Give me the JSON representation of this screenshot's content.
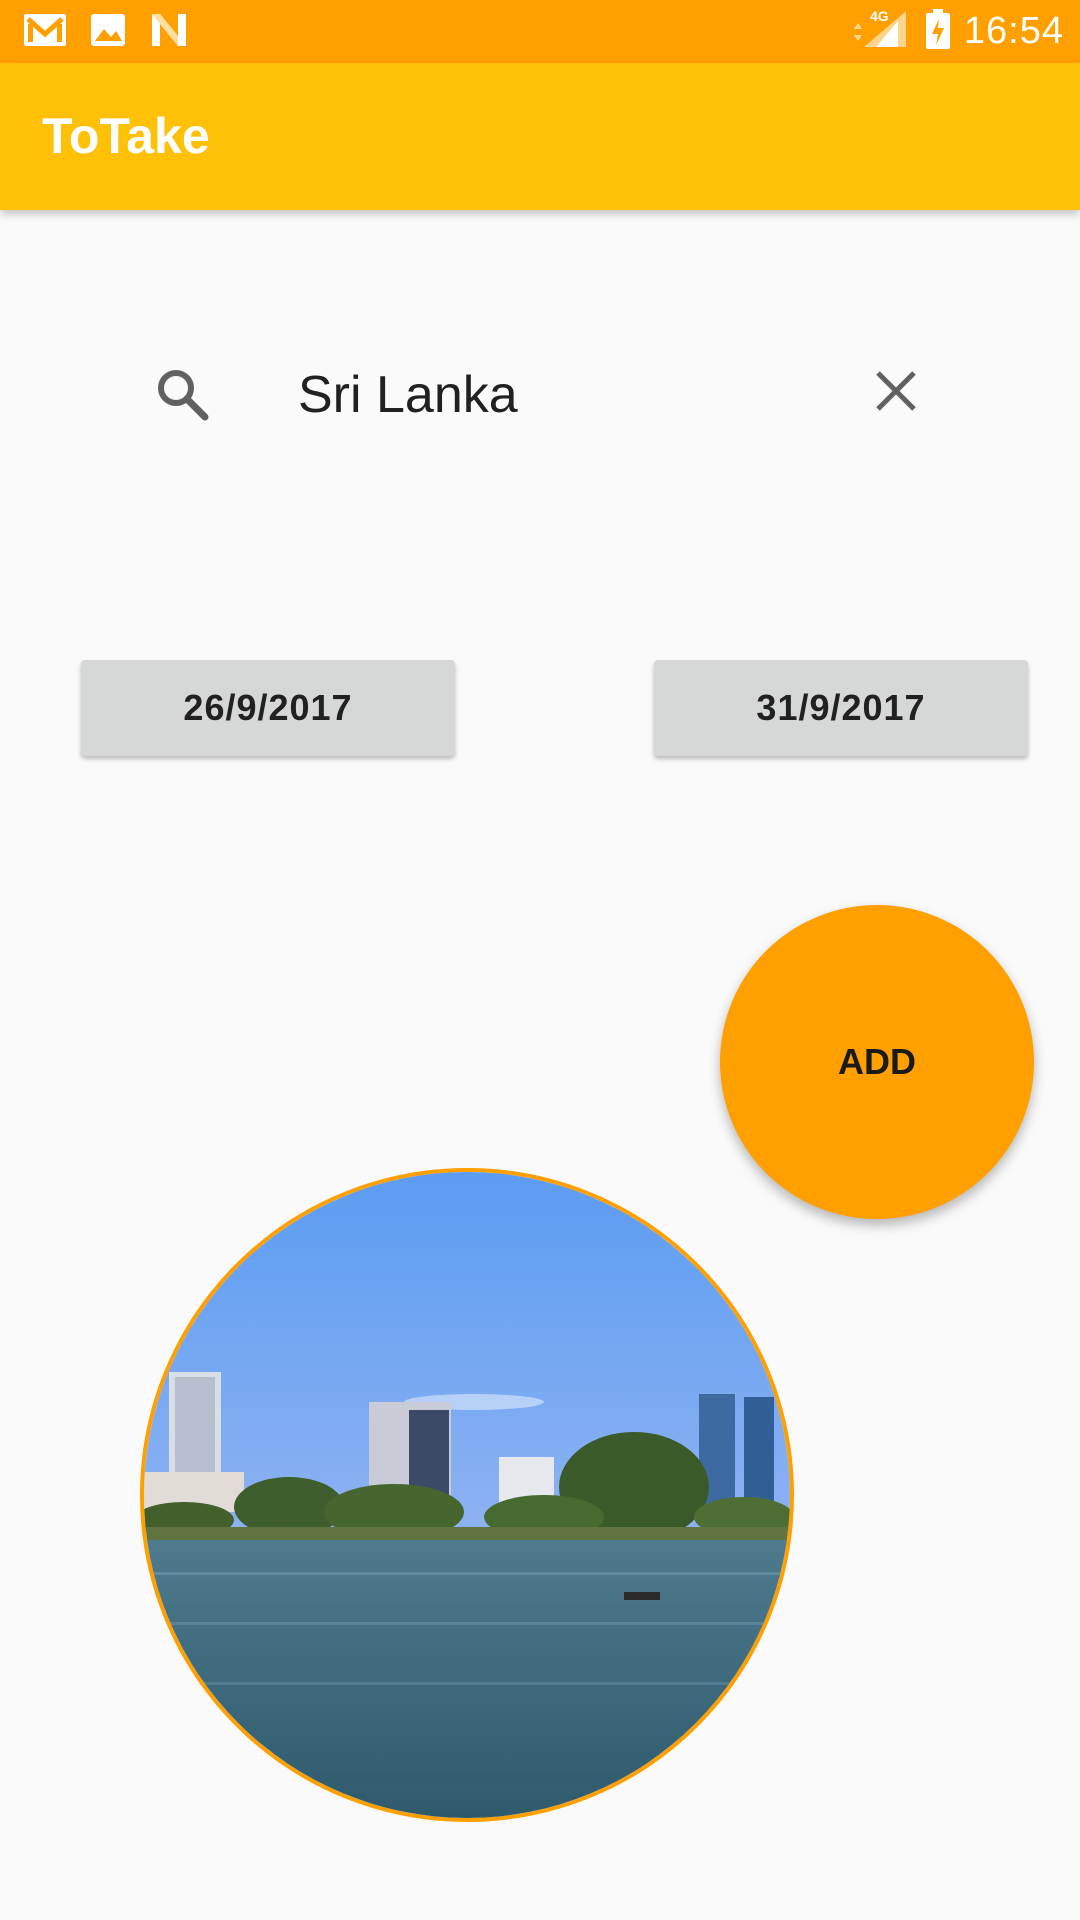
{
  "status_bar": {
    "time": "16:54",
    "network": "4G",
    "left_icons": [
      "gmail-icon",
      "image-icon",
      "n-logo-icon"
    ],
    "right_icons": [
      "signal-icon",
      "battery-charging-icon"
    ]
  },
  "app_bar": {
    "title": "ToTake"
  },
  "search": {
    "value": "Sri Lanka"
  },
  "dates": {
    "start": "26/9/2017",
    "end": "31/9/2017"
  },
  "add_button": {
    "label": "ADD"
  },
  "colors": {
    "status_bar": "#ff9f00",
    "app_bar": "#ffc107",
    "accent": "#ff9f00",
    "date_button": "#d6d7d7",
    "background": "#fafafa"
  }
}
